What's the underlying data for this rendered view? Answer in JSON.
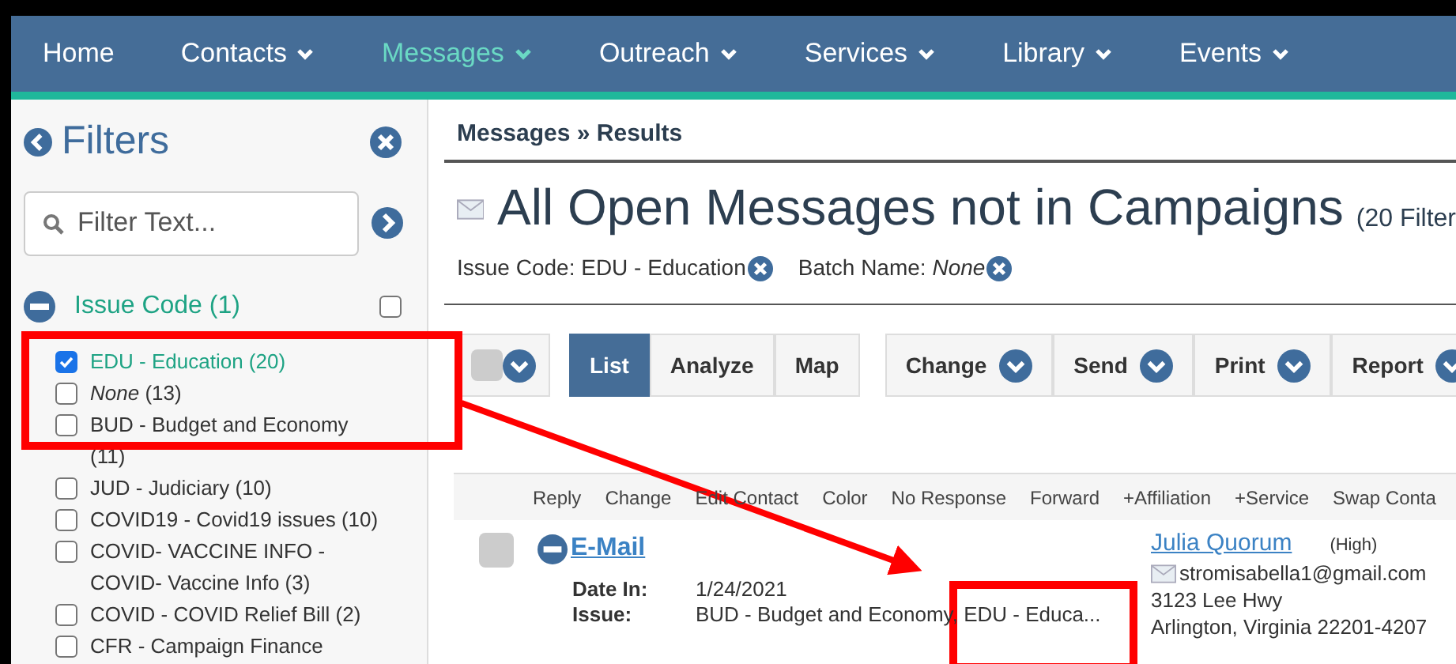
{
  "nav": [
    {
      "label": "Home",
      "dropdown": false,
      "selected": false
    },
    {
      "label": "Contacts",
      "dropdown": true,
      "selected": false
    },
    {
      "label": "Messages",
      "dropdown": true,
      "selected": true
    },
    {
      "label": "Outreach",
      "dropdown": true,
      "selected": false
    },
    {
      "label": "Services",
      "dropdown": true,
      "selected": false
    },
    {
      "label": "Library",
      "dropdown": true,
      "selected": false
    },
    {
      "label": "Events",
      "dropdown": true,
      "selected": false
    }
  ],
  "filters": {
    "title": "Filters",
    "search_placeholder": "Filter Text...",
    "groups": [
      {
        "label": "Issue Code (1)",
        "expanded": true,
        "checked": false,
        "items": [
          {
            "label": "EDU - Education (20)",
            "checked": true
          },
          {
            "label": "*None* (13)",
            "checked": false
          },
          {
            "label": "BUD - Budget and Economy (11)",
            "checked": false
          },
          {
            "label": "JUD - Judiciary (10)",
            "checked": false
          },
          {
            "label": "COVID19 - Covid19 issues (10)",
            "checked": false
          },
          {
            "label": "COVID- VACCINE INFO - COVID- Vaccine Info (3)",
            "checked": false
          },
          {
            "label": "COVID - COVID Relief Bill (2)",
            "checked": false
          },
          {
            "label": "CFR - Campaign Finance",
            "checked": false
          }
        ]
      }
    ]
  },
  "breadcrumb": "Messages » Results",
  "title": "All Open Messages not in Campaigns",
  "title_note": "(20 Filter",
  "active_filters": [
    {
      "label": "Issue Code: EDU - Education"
    },
    {
      "label": "Batch Name: *None*"
    }
  ],
  "toolbar": {
    "select_all_checked": false,
    "views": [
      {
        "label": "List",
        "selected": true
      },
      {
        "label": "Analyze",
        "selected": false
      },
      {
        "label": "Map",
        "selected": false
      }
    ],
    "actions": [
      "Change",
      "Send",
      "Print",
      "Report"
    ]
  },
  "row_actions": [
    "Reply",
    "Change",
    "Edit Contact",
    "Color",
    "No Response",
    "Forward",
    "+Affiliation",
    "+Service",
    "Swap Conta"
  ],
  "messages": [
    {
      "checked": false,
      "type": "E-Mail",
      "fields": [
        {
          "label": "Date In:",
          "value": "1/24/2021"
        },
        {
          "label": "Issue:",
          "value": "BUD - Budget and Economy, EDU - Educa..."
        }
      ],
      "contact": {
        "name": "Julia Quorum",
        "priority": "(High)",
        "email": "stromisabella1@gmail.com",
        "address": [
          "3123 Lee Hwy",
          "Arlington, Virginia 22201-4207"
        ]
      }
    }
  ]
}
